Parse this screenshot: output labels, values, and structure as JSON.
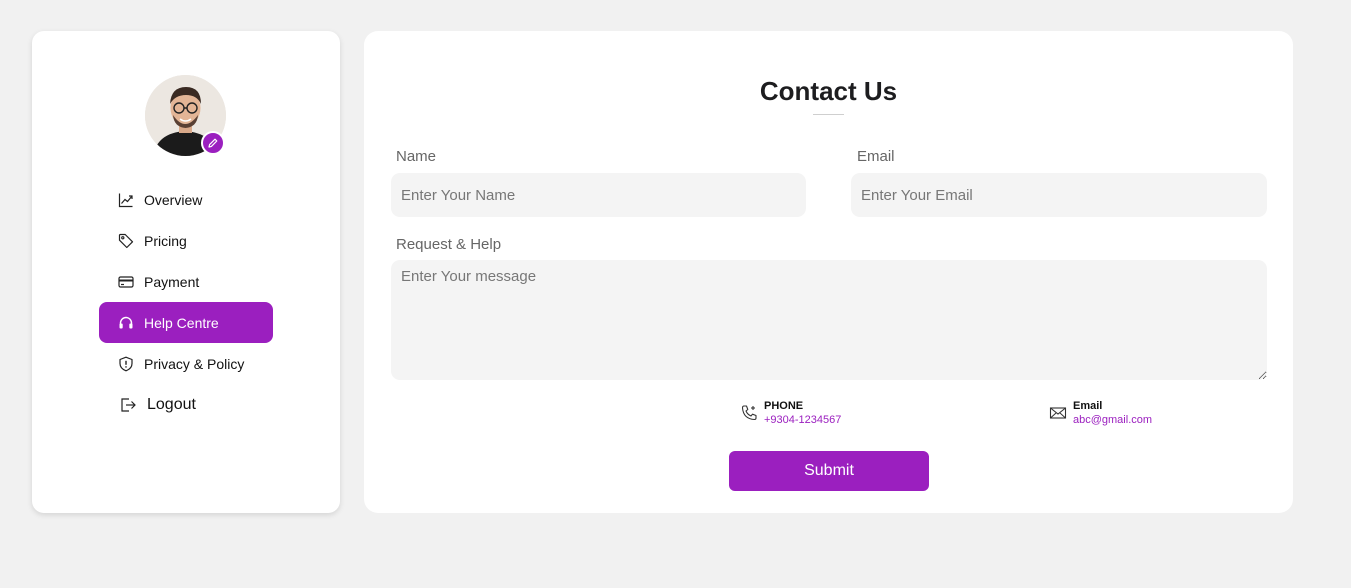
{
  "colors": {
    "accent": "#9b1fbf",
    "background": "#f1f1f1",
    "field": "#f4f4f4"
  },
  "sidebar": {
    "avatar_icon": "user-avatar",
    "items": [
      {
        "label": "Overview",
        "icon": "trend-chart-icon",
        "active": false
      },
      {
        "label": "Pricing",
        "icon": "tag-icon",
        "active": false
      },
      {
        "label": "Payment",
        "icon": "credit-card-icon",
        "active": false
      },
      {
        "label": "Help Centre",
        "icon": "headset-icon",
        "active": true
      },
      {
        "label": "Privacy & Policy",
        "icon": "shield-icon",
        "active": false
      }
    ],
    "logout_label": "Logout"
  },
  "main": {
    "title": "Contact Us",
    "name_label": "Name",
    "name_placeholder": "Enter Your Name",
    "email_label": "Email",
    "email_placeholder": "Enter Your Email",
    "request_label": "Request & Help",
    "message_placeholder": "Enter Your message",
    "phone_key": "PHONE",
    "phone_value": "+9304-1234567",
    "email_key": "Email",
    "email_value": "abc@gmail.com",
    "submit_label": "Submit"
  }
}
